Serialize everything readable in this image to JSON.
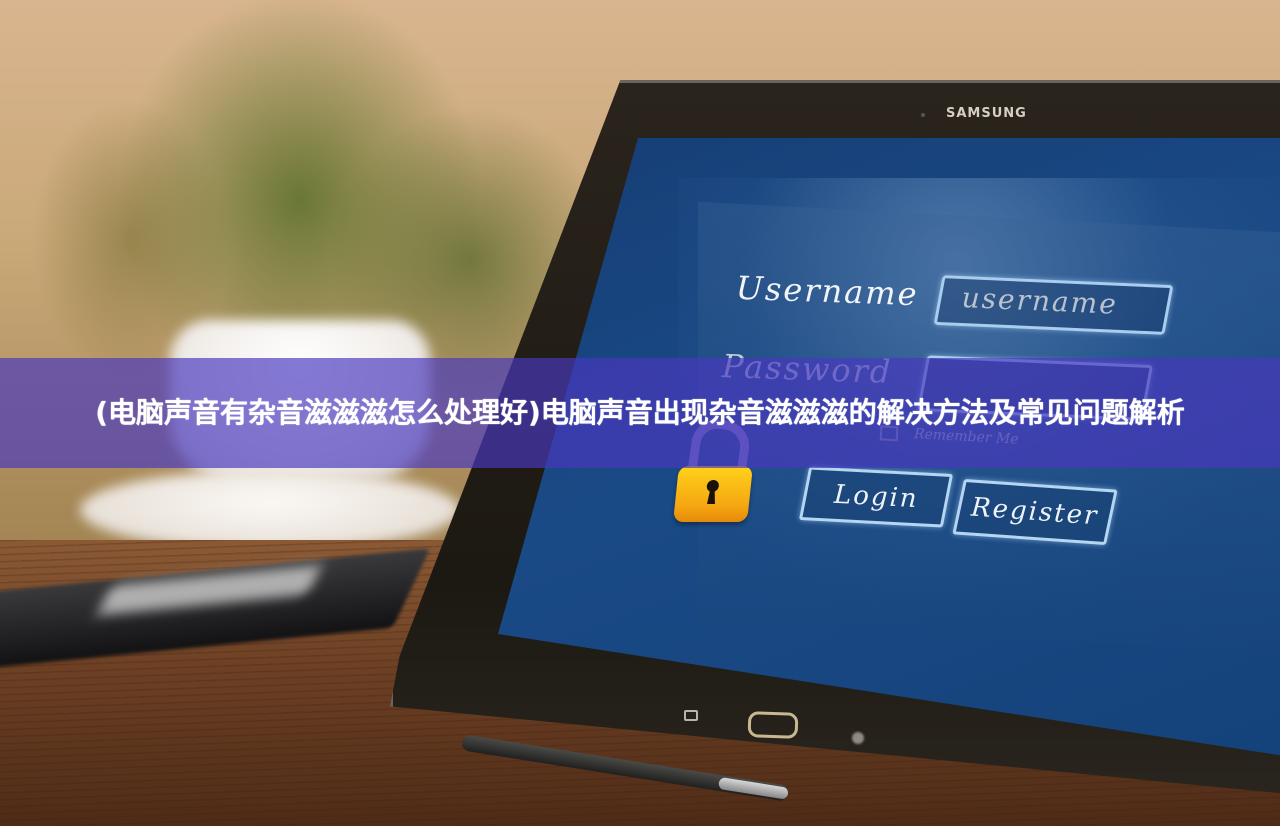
{
  "banner": {
    "title": "(电脑声音有杂音滋滋滋怎么处理好)电脑声音出现杂音滋滋滋的解决方法及常见问题解析",
    "background_color": "#4838be"
  },
  "tablet": {
    "brand": "SAMSUNG",
    "screen": {
      "username_label": "Username",
      "username_value": "username",
      "password_label": "Password",
      "remember_label": "Remember Me",
      "login_button": "Login",
      "register_button": "Register",
      "lock_color": "#f6a712",
      "screen_color": "#1a4a86"
    }
  }
}
